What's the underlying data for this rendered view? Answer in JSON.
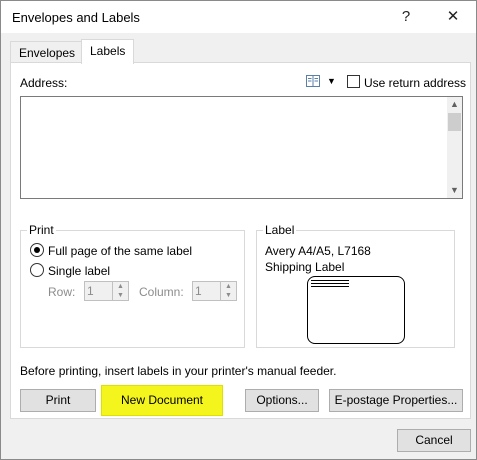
{
  "window": {
    "title": "Envelopes and Labels",
    "help": "?",
    "close": "✕"
  },
  "tabs": [
    {
      "label": "Envelopes"
    },
    {
      "label": "Labels"
    }
  ],
  "address": {
    "label": "Address:",
    "use_return_address": "Use return address",
    "value": ""
  },
  "print": {
    "group_label": "Print",
    "full_page": "Full page of the same label",
    "single_label": "Single label",
    "row_label": "Row:",
    "row_value": "1",
    "column_label": "Column:",
    "column_value": "1"
  },
  "label": {
    "group_label": "Label",
    "line1": "Avery A4/A5, L7168",
    "line2": "Shipping Label"
  },
  "note": "Before printing, insert labels in your printer's manual feeder.",
  "buttons": {
    "print": "Print",
    "new_document": "New Document",
    "options": "Options...",
    "epostage": "E-postage Properties...",
    "cancel": "Cancel"
  },
  "colors": {
    "highlight": "#f5f51e",
    "dialog_bg": "#f0f0f0"
  }
}
